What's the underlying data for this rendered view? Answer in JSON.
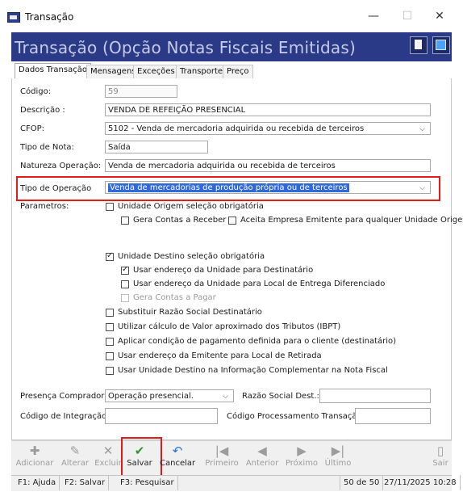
{
  "window": {
    "title": "Transação",
    "minimize": "—",
    "maximize": "☐",
    "close": "✕"
  },
  "header": {
    "title": "Transação (Opção Notas Fiscais Emitidas)",
    "bg_color": "#2b3a86"
  },
  "tabs": [
    {
      "label": "Dados Transação",
      "active": true
    },
    {
      "label": "Mensagens",
      "active": false
    },
    {
      "label": "Exceções",
      "active": false
    },
    {
      "label": "Transporte",
      "active": false
    },
    {
      "label": "Preço",
      "active": false
    }
  ],
  "form": {
    "codigo": {
      "label": "Código:",
      "value": "59"
    },
    "descricao": {
      "label": "Descrição :",
      "value": "VENDA DE REFEIÇÃO PRESENCIAL"
    },
    "cfop": {
      "label": "CFOP:",
      "value": "5102 - Venda de mercadoria adquirida ou recebida de terceiros"
    },
    "tipo_nota": {
      "label": "Tipo de Nota:",
      "value": "Saída"
    },
    "natureza": {
      "label": "Natureza Operação:",
      "value": "Venda de mercadoria adquirida ou recebida de terceiros"
    },
    "tipo_operacao": {
      "label": "Tipo de Operação",
      "value": "Venda de mercadorias de produção própria ou de terceiros"
    },
    "parametros_label": "Parametros:"
  },
  "checkboxes": {
    "unidade_origem": {
      "label": "Unidade Origem seleção obrigatória",
      "checked": false
    },
    "gera_contas_receber": {
      "label": "Gera Contas a Receber",
      "checked": false
    },
    "aceita_empresa": {
      "label": "Aceita Empresa Emitente para qualquer Unidade Origem",
      "checked": false
    },
    "unidade_destino": {
      "label": "Unidade Destino seleção obrigatória",
      "checked": true
    },
    "usar_end_destinatario": {
      "label": "Usar endereço da Unidade para Destinatário",
      "checked": true
    },
    "usar_end_entrega": {
      "label": "Usar endereço da Unidade para Local de Entrega Diferenciado",
      "checked": false
    },
    "gera_contas_pagar": {
      "label": "Gera Contas a Pagar",
      "checked": false,
      "disabled": true
    },
    "substituir_razao": {
      "label": "Substituir Razão Social Destinatário",
      "checked": false
    },
    "ibpt": {
      "label": "Utilizar cálculo de Valor aproximado dos Tributos (IBPT)",
      "checked": false
    },
    "condicao_pagamento": {
      "label": "Aplicar condição de pagamento definida para o cliente (destinatário)",
      "checked": false
    },
    "endereco_emitente": {
      "label": "Usar endereço da Emitente para Local de Retirada",
      "checked": false
    },
    "unidade_destino_info": {
      "label": "Usar Unidade Destino na Informação Complementar na Nota Fiscal",
      "checked": false
    }
  },
  "bottom": {
    "presenca_label": "Presença Comprador:",
    "presenca_value": "Operação presencial.",
    "razao_label": "Razão Social Dest.:",
    "razao_value": "",
    "integracao_label": "Código de Integração:",
    "integracao_value": "",
    "processamento_label": "Código Processamento Transação:",
    "processamento_value": ""
  },
  "toolbar": {
    "adicionar": "Adicionar",
    "alterar": "Alterar",
    "excluir": "Excluir",
    "salvar": "Salvar",
    "cancelar": "Cancelar",
    "primeiro": "Primeiro",
    "anterior": "Anterior",
    "proximo": "Próximo",
    "ultimo": "Último",
    "sair": "Sair"
  },
  "statusbar": {
    "help": "F1: Ajuda",
    "save": "F2: Salvar",
    "search": "F3: Pesquisar",
    "record": "50 de 50",
    "datetime": "27/11/2025 10:28"
  },
  "colors": {
    "highlight": "#e31b1b",
    "selection": "#2f68d8",
    "save_icon": "#2e9a2e",
    "cancel_icon": "#2b6fd1"
  }
}
